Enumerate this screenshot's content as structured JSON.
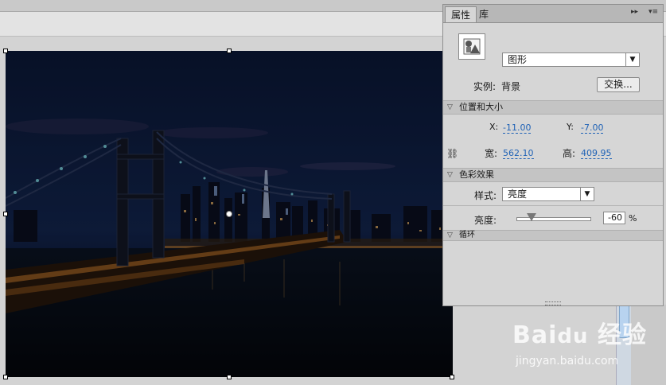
{
  "panel": {
    "tabs": {
      "properties": "属性",
      "library": "库"
    },
    "controls": {
      "collapse": "▸▸",
      "menu": "▾≡"
    },
    "symbol_icon": "graphic-symbol-icon",
    "symbol_type": "图形",
    "instance": {
      "label": "实例:",
      "name": "背景",
      "swap_button": "交换..."
    },
    "position_size": {
      "section_title": "位置和大小",
      "x_label": "X:",
      "x_value": "-11.00",
      "y_label": "Y:",
      "y_value": "-7.00",
      "w_label": "宽:",
      "w_value": "562.10",
      "h_label": "高:",
      "h_value": "409.95"
    },
    "color_effect": {
      "section_title": "色彩效果",
      "style_label": "样式:",
      "style_value": "亮度",
      "brightness_label": "亮度:",
      "brightness_value": "-60",
      "brightness_unit": "%",
      "brightness_level": -60
    },
    "loop": {
      "section_title": "循环"
    }
  },
  "watermark": {
    "logo": "Baidu 经验",
    "url": "jingyan.baidu.com"
  },
  "colors": {
    "link": "#1f62b6",
    "panel_bg": "#d6d6d6",
    "stage_bg": "#d3d3d3"
  }
}
